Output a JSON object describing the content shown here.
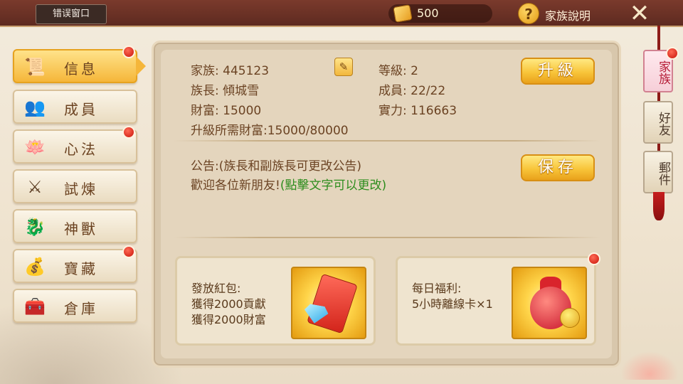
{
  "topbar": {
    "title_watermark": "家族",
    "error_window_label": "错误窗口",
    "gold": "500",
    "help_label": "家族說明"
  },
  "nav": {
    "items": [
      {
        "label": "信息",
        "icon": "scroll-icon",
        "active": true,
        "badge": true
      },
      {
        "label": "成員",
        "icon": "members-icon",
        "active": false,
        "badge": false
      },
      {
        "label": "心法",
        "icon": "lotus-icon",
        "active": false,
        "badge": true
      },
      {
        "label": "試煉",
        "icon": "trial-icon",
        "active": false,
        "badge": false
      },
      {
        "label": "神獸",
        "icon": "dragon-icon",
        "active": false,
        "badge": false
      },
      {
        "label": "寶藏",
        "icon": "treasure-icon",
        "active": false,
        "badge": true
      },
      {
        "label": "倉庫",
        "icon": "chest-icon",
        "active": false,
        "badge": false
      }
    ]
  },
  "info": {
    "family_label": "家族:",
    "family_value": "445123",
    "leader_label": "族長:",
    "leader_value": "傾城雪",
    "wealth_label": "財富:",
    "wealth_value": "15000",
    "level_label": "等級:",
    "level_value": "2",
    "members_label": "成員:",
    "members_value": "22/22",
    "power_label": "實力:",
    "power_value": "116663",
    "upgrade_req": "升級所需財富:15000/80000",
    "upgrade_button": "升級"
  },
  "notice": {
    "title": "公告:(族長和副族長可更改公告)",
    "content": "歡迎各位新朋友!",
    "hint": "(點擊文字可以更改)",
    "save_button": "保存"
  },
  "rewards": [
    {
      "line1": "發放紅包:",
      "line2": "獲得2000貢獻",
      "line3": "獲得2000財富",
      "icon": "red-packet-icon"
    },
    {
      "line1": "每日福利:",
      "line2": "5小時離線卡×1",
      "line3": "",
      "icon": "lucky-bag-icon"
    }
  ],
  "right_tabs": [
    "家族",
    "好友",
    "郵件"
  ],
  "colors": {
    "accent_gold": "#f8c53a",
    "badge_red": "#c8140a",
    "hint_green": "#2e8d1e"
  }
}
